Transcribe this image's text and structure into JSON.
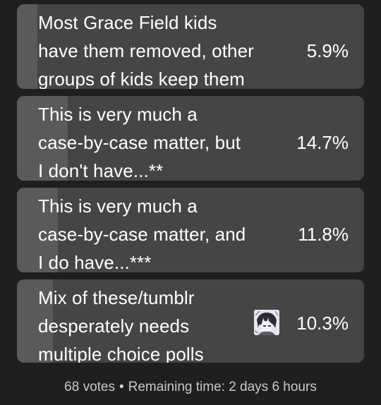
{
  "poll": {
    "options": [
      {
        "text": "Most Grace Field kids\nhave them removed, other\ngroups of kids keep them",
        "percent_label": "5.9%",
        "percent": 5.9
      },
      {
        "text": "This is very much a\ncase-by-case matter, but\nI don't have...**",
        "percent_label": "14.7%",
        "percent": 14.7
      },
      {
        "text": "This is very much a\ncase-by-case matter, and\nI do have...***",
        "percent_label": "11.8%",
        "percent": 11.8
      },
      {
        "text": "Mix of these/tumblr\ndesperately needs\nmultiple choice polls",
        "percent_label": "10.3%",
        "percent": 10.3,
        "voter_avatar_icon": "anime-avatar-icon"
      }
    ],
    "votes_label": "68 votes",
    "separator": "•",
    "remaining_label": "Remaining time: 2 days 6 hours"
  }
}
